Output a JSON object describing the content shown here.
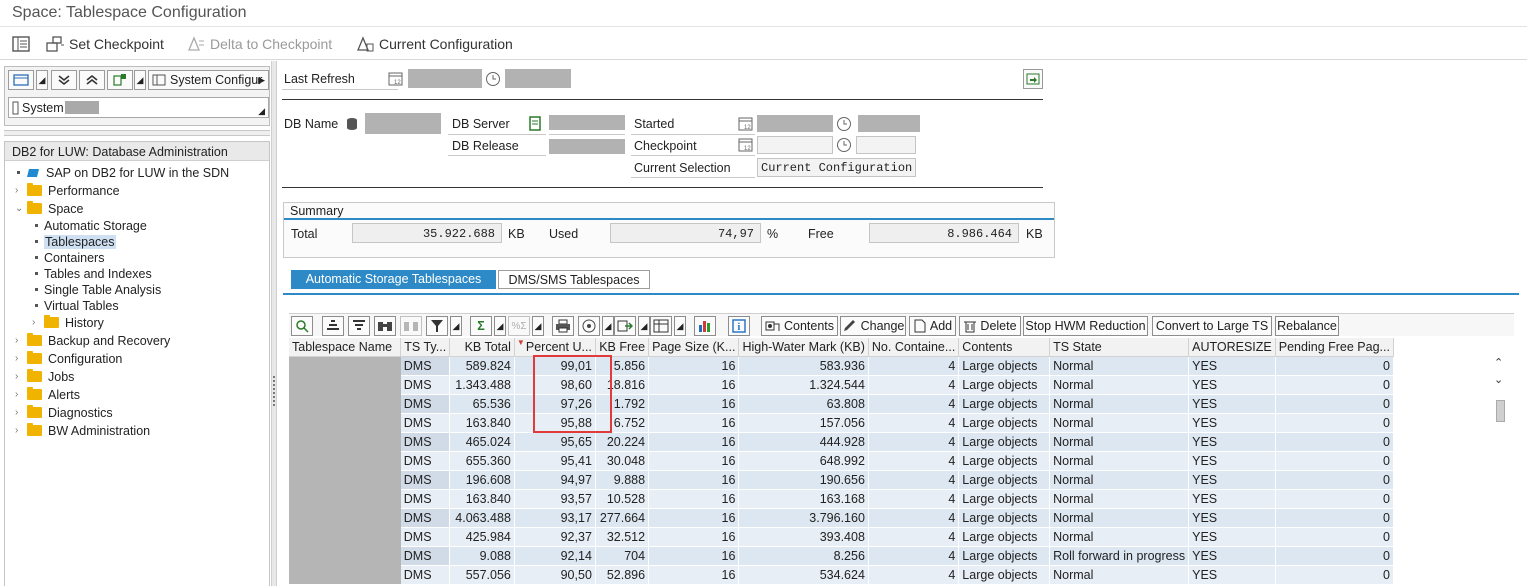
{
  "window": {
    "title": "Space: Tablespace Configuration"
  },
  "toolbar": {
    "set_checkpoint": "Set Checkpoint",
    "delta_to_checkpoint": "Delta to Checkpoint",
    "current_configuration": "Current Configuration"
  },
  "left_top": {
    "view_dropdown": "System Configur",
    "system_label": "System"
  },
  "tree": {
    "header": "DB2 for LUW: Database Administration",
    "items": [
      {
        "label": "SAP on DB2 for LUW in the SDN",
        "kind": "link"
      },
      {
        "label": "Performance",
        "kind": "folder"
      },
      {
        "label": "Space",
        "kind": "folder-open"
      },
      {
        "label": "Automatic Storage",
        "kind": "leaf"
      },
      {
        "label": "Tablespaces",
        "kind": "leaf-selected"
      },
      {
        "label": "Containers",
        "kind": "leaf"
      },
      {
        "label": "Tables and Indexes",
        "kind": "leaf"
      },
      {
        "label": "Single Table Analysis",
        "kind": "leaf"
      },
      {
        "label": "Virtual Tables",
        "kind": "leaf"
      },
      {
        "label": "History",
        "kind": "folder"
      },
      {
        "label": "Backup and Recovery",
        "kind": "folder"
      },
      {
        "label": "Configuration",
        "kind": "folder"
      },
      {
        "label": "Jobs",
        "kind": "folder"
      },
      {
        "label": "Alerts",
        "kind": "folder"
      },
      {
        "label": "Diagnostics",
        "kind": "folder"
      },
      {
        "label": "BW Administration",
        "kind": "folder"
      }
    ]
  },
  "header_fields": {
    "last_refresh": "Last Refresh",
    "db_name": "DB Name",
    "db_server": "DB Server",
    "db_release": "DB Release",
    "started": "Started",
    "checkpoint": "Checkpoint",
    "current_selection": "Current Selection",
    "current_selection_value": "Current Configuration"
  },
  "summary": {
    "title": "Summary",
    "total_label": "Total",
    "total_value": "35.922.688",
    "total_unit": "KB",
    "used_label": "Used",
    "used_value": "74,97",
    "used_unit": "%",
    "free_label": "Free",
    "free_value": "8.986.464",
    "free_unit": "KB"
  },
  "tabs": {
    "automatic": "Automatic Storage Tablespaces",
    "dms": "DMS/SMS Tablespaces"
  },
  "grid_toolbar": {
    "contents": "Contents",
    "change": "Change",
    "add": "Add",
    "delete": "Delete",
    "stop_hwm": "Stop HWM Reduction",
    "convert": "Convert to Large TS",
    "rebalance": "Rebalance"
  },
  "table": {
    "columns": [
      "Tablespace Name",
      "TS Ty...",
      "KB Total",
      "Percent U...",
      "KB Free",
      "Page Size (K...",
      "High-Water Mark (KB)",
      "No. Containe...",
      "Contents",
      "TS State",
      "AUTORESIZE",
      "Pending Free Pag..."
    ],
    "rows": [
      [
        "DMS",
        "589.824",
        "99,01",
        "5.856",
        "16",
        "583.936",
        "4",
        "Large objects",
        "Normal",
        "YES",
        "0"
      ],
      [
        "DMS",
        "1.343.488",
        "98,60",
        "18.816",
        "16",
        "1.324.544",
        "4",
        "Large objects",
        "Normal",
        "YES",
        "0"
      ],
      [
        "DMS",
        "65.536",
        "97,26",
        "1.792",
        "16",
        "63.808",
        "4",
        "Large objects",
        "Normal",
        "YES",
        "0"
      ],
      [
        "DMS",
        "163.840",
        "95,88",
        "6.752",
        "16",
        "157.056",
        "4",
        "Large objects",
        "Normal",
        "YES",
        "0"
      ],
      [
        "DMS",
        "465.024",
        "95,65",
        "20.224",
        "16",
        "444.928",
        "4",
        "Large objects",
        "Normal",
        "YES",
        "0"
      ],
      [
        "DMS",
        "655.360",
        "95,41",
        "30.048",
        "16",
        "648.992",
        "4",
        "Large objects",
        "Normal",
        "YES",
        "0"
      ],
      [
        "DMS",
        "196.608",
        "94,97",
        "9.888",
        "16",
        "190.656",
        "4",
        "Large objects",
        "Normal",
        "YES",
        "0"
      ],
      [
        "DMS",
        "163.840",
        "93,57",
        "10.528",
        "16",
        "163.168",
        "4",
        "Large objects",
        "Normal",
        "YES",
        "0"
      ],
      [
        "DMS",
        "4.063.488",
        "93,17",
        "277.664",
        "16",
        "3.796.160",
        "4",
        "Large objects",
        "Normal",
        "YES",
        "0"
      ],
      [
        "DMS",
        "425.984",
        "92,37",
        "32.512",
        "16",
        "393.408",
        "4",
        "Large objects",
        "Normal",
        "YES",
        "0"
      ],
      [
        "DMS",
        "9.088",
        "92,14",
        "704",
        "16",
        "8.256",
        "4",
        "Large objects",
        "Roll forward in progress",
        "YES",
        "0"
      ],
      [
        "DMS",
        "557.056",
        "90,50",
        "52.896",
        "16",
        "534.624",
        "4",
        "Large objects",
        "Normal",
        "YES",
        "0"
      ]
    ]
  },
  "colors": {
    "accent": "#2d8ac7",
    "highlight": "#e13a3a",
    "folder": "#f0b400"
  }
}
